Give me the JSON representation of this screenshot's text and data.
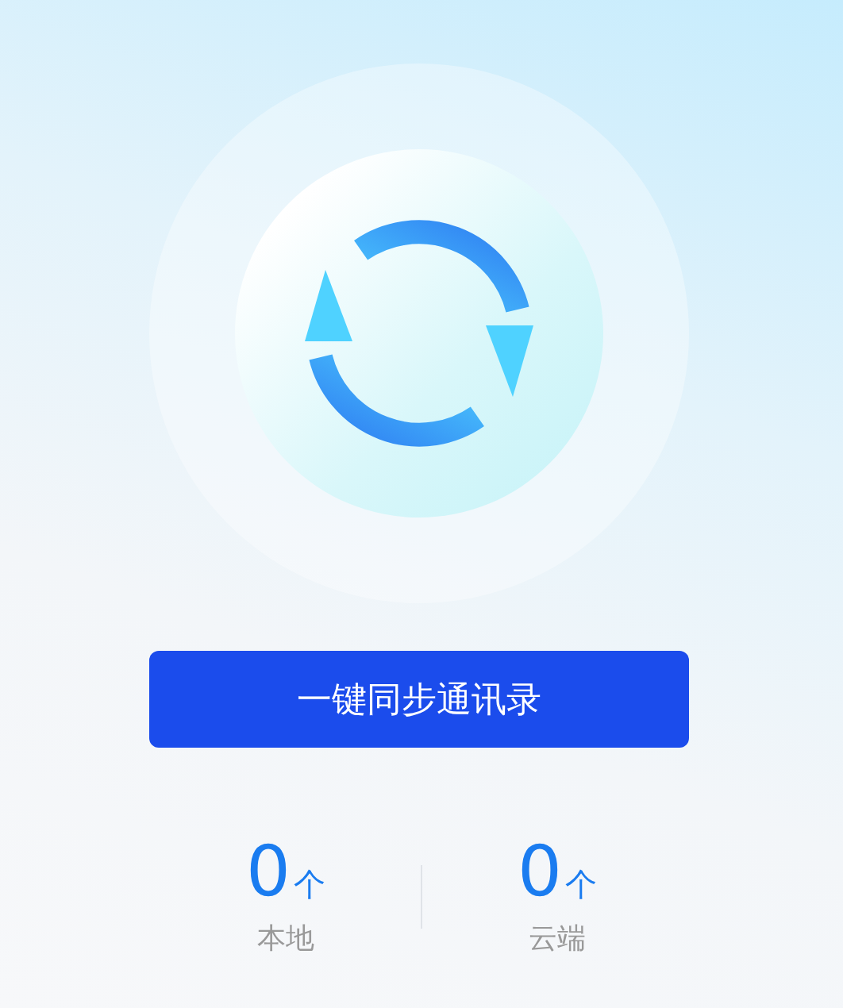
{
  "button": {
    "label": "一键同步通讯录"
  },
  "stats": [
    {
      "value": "0",
      "unit": "个",
      "label": "本地"
    },
    {
      "value": "0",
      "unit": "个",
      "label": "云端"
    }
  ]
}
